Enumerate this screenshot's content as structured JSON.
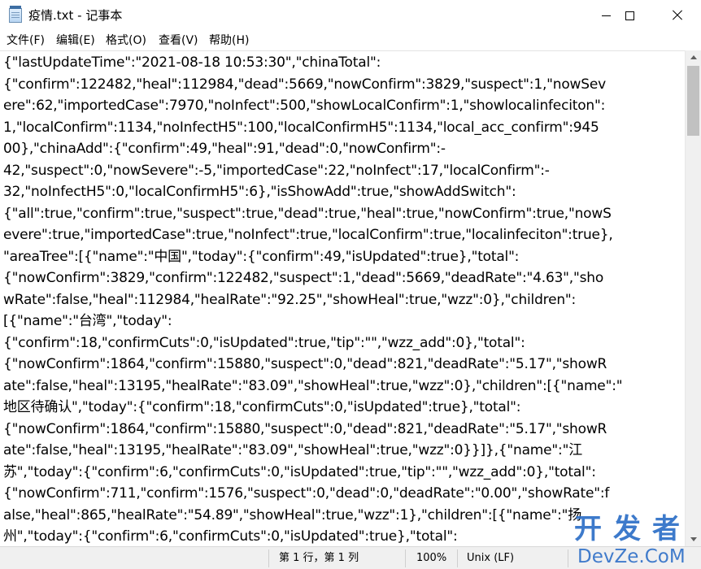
{
  "window": {
    "title": "疫情.txt - 记事本",
    "minimize_icon": "minimize-icon",
    "maximize_icon": "maximize-icon",
    "close_icon": "close-icon"
  },
  "menu": [
    "文件(F)",
    "编辑(E)",
    "格式(O)",
    "查看(V)",
    "帮助(H)"
  ],
  "editor": {
    "lines": [
      "{\"lastUpdateTime\":\"2021-08-18 10:53:30\",\"chinaTotal\":",
      "{\"confirm\":122482,\"heal\":112984,\"dead\":5669,\"nowConfirm\":3829,\"suspect\":1,\"nowSev",
      "ere\":62,\"importedCase\":7970,\"noInfect\":500,\"showLocalConfirm\":1,\"showlocalinfeciton\":",
      "1,\"localConfirm\":1134,\"noInfectH5\":100,\"localConfirmH5\":1134,\"local_acc_confirm\":945",
      "00},\"chinaAdd\":{\"confirm\":49,\"heal\":91,\"dead\":0,\"nowConfirm\":-",
      "42,\"suspect\":0,\"nowSevere\":-5,\"importedCase\":22,\"noInfect\":17,\"localConfirm\":-",
      "32,\"noInfectH5\":0,\"localConfirmH5\":6},\"isShowAdd\":true,\"showAddSwitch\":",
      "{\"all\":true,\"confirm\":true,\"suspect\":true,\"dead\":true,\"heal\":true,\"nowConfirm\":true,\"nowS",
      "evere\":true,\"importedCase\":true,\"noInfect\":true,\"localConfirm\":true,\"localinfeciton\":true},",
      "\"areaTree\":[{\"name\":\"中国\",\"today\":{\"confirm\":49,\"isUpdated\":true},\"total\":",
      "{\"nowConfirm\":3829,\"confirm\":122482,\"suspect\":1,\"dead\":5669,\"deadRate\":\"4.63\",\"sho",
      "wRate\":false,\"heal\":112984,\"healRate\":\"92.25\",\"showHeal\":true,\"wzz\":0},\"children\":",
      "[{\"name\":\"台湾\",\"today\":",
      "{\"confirm\":18,\"confirmCuts\":0,\"isUpdated\":true,\"tip\":\"\",\"wzz_add\":0},\"total\":",
      "{\"nowConfirm\":1864,\"confirm\":15880,\"suspect\":0,\"dead\":821,\"deadRate\":\"5.17\",\"showR",
      "ate\":false,\"heal\":13195,\"healRate\":\"83.09\",\"showHeal\":true,\"wzz\":0},\"children\":[{\"name\":\"",
      "地区待确认\",\"today\":{\"confirm\":18,\"confirmCuts\":0,\"isUpdated\":true},\"total\":",
      "{\"nowConfirm\":1864,\"confirm\":15880,\"suspect\":0,\"dead\":821,\"deadRate\":\"5.17\",\"showR",
      "ate\":false,\"heal\":13195,\"healRate\":\"83.09\",\"showHeal\":true,\"wzz\":0}}]},{\"name\":\"江",
      "苏\",\"today\":{\"confirm\":6,\"confirmCuts\":0,\"isUpdated\":true,\"tip\":\"\",\"wzz_add\":0},\"total\":",
      "{\"nowConfirm\":711,\"confirm\":1576,\"suspect\":0,\"dead\":0,\"deadRate\":\"0.00\",\"showRate\":f",
      "alse,\"heal\":865,\"healRate\":\"54.89\",\"showHeal\":true,\"wzz\":1},\"children\":[{\"name\":\"扬",
      "州\",\"today\":{\"confirm\":6,\"confirmCuts\":0,\"isUpdated\":true},\"total\":"
    ]
  },
  "status": {
    "position": "第 1 行，第 1 列",
    "zoom": "100%",
    "line_ending": "Unix (LF)"
  },
  "watermark": {
    "top": "开发者",
    "bottom": "DevZe.CoM"
  }
}
